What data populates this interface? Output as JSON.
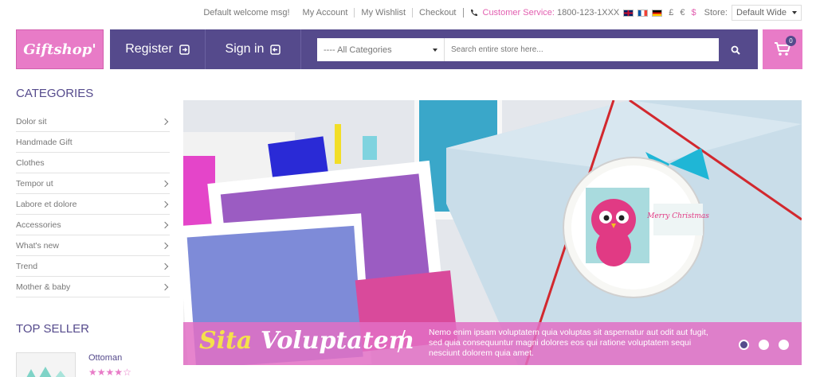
{
  "topbar": {
    "welcome": "Default welcome msg!",
    "links": [
      "My Account",
      "My Wishlist",
      "Checkout"
    ],
    "customer_service_label": "Customer Service:",
    "phone": "1800-123-1XXX",
    "currencies": [
      "£",
      "€",
      "$"
    ],
    "active_currency": "$",
    "store_label": "Store:",
    "store_value": "Default Wide"
  },
  "header": {
    "logo_text": "Giftshop'",
    "register_label": "Register",
    "signin_label": "Sign in",
    "category_select": "---- All Categories",
    "search_placeholder": "Search entire store here...",
    "cart_count": "0"
  },
  "sidebar": {
    "categories_title": "CATEGORIES",
    "categories": [
      {
        "label": "Dolor sit",
        "has_children": true
      },
      {
        "label": "Handmade Gift",
        "has_children": false
      },
      {
        "label": "Clothes",
        "has_children": false
      },
      {
        "label": "Tempor ut",
        "has_children": true
      },
      {
        "label": "Labore et dolore",
        "has_children": true
      },
      {
        "label": "Accessories",
        "has_children": true
      },
      {
        "label": "What's new",
        "has_children": true
      },
      {
        "label": "Trend",
        "has_children": true
      },
      {
        "label": "Mother & baby",
        "has_children": true
      }
    ],
    "top_seller_title": "TOP SELLER",
    "top_seller_item": "Ottoman",
    "top_seller_rating": 4
  },
  "banner": {
    "title_highlight": "Sita",
    "title_rest": "Voluptatem",
    "text": "Nemo enim ipsam voluptatem quia voluptas sit aspernatur aut odit aut fugit, sed quia consequuntur magni dolores eos qui ratione voluptatem sequi nesciunt dolorem quia amet.",
    "tag_text": "Merry Christmas",
    "slide_count": 3,
    "active_slide": 1
  },
  "colors": {
    "brand_purple": "#554a8c",
    "brand_pink": "#e87bc7",
    "accent_pink": "#e25fb0"
  }
}
